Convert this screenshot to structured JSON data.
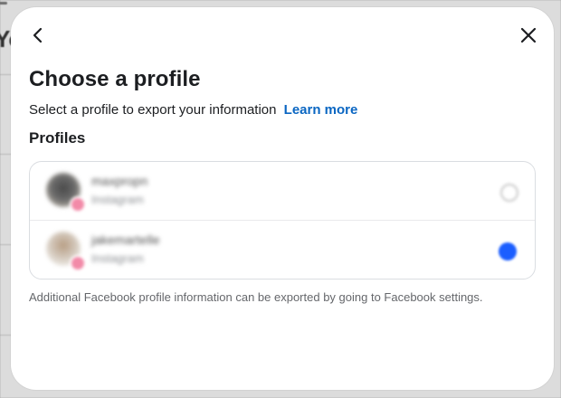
{
  "background": {
    "page_title_fragment": "Yo"
  },
  "modal": {
    "title": "Choose a profile",
    "subtitle": "Select a profile to export your information",
    "learn_more_label": "Learn more",
    "section_label": "Profiles",
    "profiles": [
      {
        "name": "maxpropn",
        "platform": "Instagram",
        "selected": false
      },
      {
        "name": "jakemartelle",
        "platform": "Instagram",
        "selected": true
      }
    ],
    "footnote": "Additional Facebook profile information can be exported by going to Facebook settings."
  },
  "colors": {
    "link": "#0a66c2",
    "selected_radio": "#1b5eff",
    "text_primary": "#1c1e21",
    "text_secondary": "#65676b"
  },
  "icons": {
    "back": "chevron-left-icon",
    "close": "close-icon",
    "profile_badge": "instagram-badge-icon"
  }
}
